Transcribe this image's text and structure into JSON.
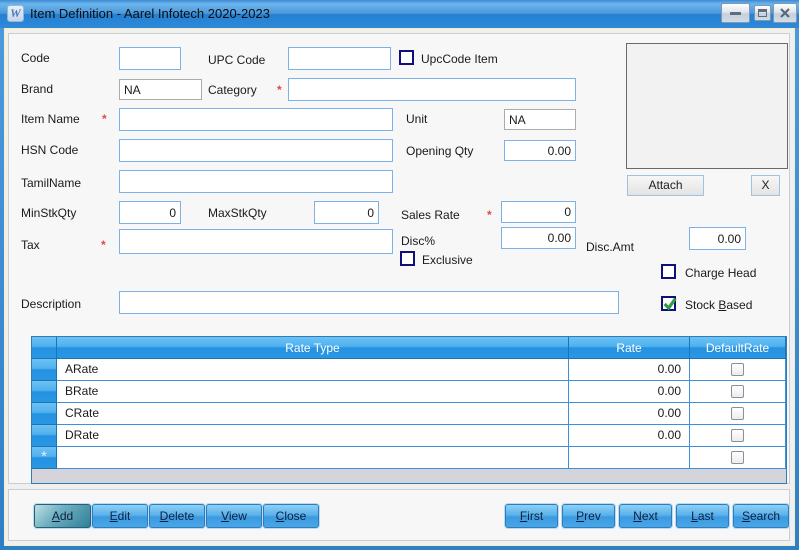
{
  "window": {
    "title": "Item Definition - Aarel Infotech 2020-2023"
  },
  "form": {
    "fields": {
      "code": {
        "label": "Code",
        "value": ""
      },
      "upc_code": {
        "label": "UPC Code",
        "value": ""
      },
      "upccode_item": {
        "label": "UpcCode Item",
        "checked": false
      },
      "brand": {
        "label": "Brand",
        "value": "NA"
      },
      "category": {
        "label": "Category",
        "required": "*",
        "value": ""
      },
      "item_name": {
        "label": "Item Name",
        "required": "*",
        "value": ""
      },
      "unit": {
        "label": "Unit",
        "value": "NA"
      },
      "hsn_code": {
        "label": "HSN Code",
        "value": ""
      },
      "opening_qty": {
        "label": "Opening Qty",
        "value": "0.00"
      },
      "tamil_name": {
        "label": "TamilName",
        "value": ""
      },
      "min_stk_qty": {
        "label": "MinStkQty",
        "value": "0"
      },
      "max_stk_qty": {
        "label": "MaxStkQty",
        "value": "0"
      },
      "sales_rate": {
        "label": "Sales Rate",
        "required": "*",
        "value": "0"
      },
      "tax": {
        "label": "Tax",
        "required": "*",
        "value": ""
      },
      "disc_pct": {
        "label": "Disc%",
        "value": "0.00"
      },
      "disc_amt": {
        "label": "Disc.Amt",
        "value": "0.00"
      },
      "exclusive": {
        "label": "Exclusive",
        "checked": false
      },
      "charge_head": {
        "label": "Charge Head",
        "checked": false
      },
      "stock_based": {
        "text": "Stock Based",
        "mnemonic": "B",
        "checked": true
      },
      "description": {
        "label": "Description",
        "value": ""
      }
    },
    "attach": {
      "attach_label": "Attach",
      "clear_label": "X"
    }
  },
  "grid": {
    "columns": [
      "Rate Type",
      "Rate",
      "DefaultRate"
    ],
    "rows": [
      {
        "rate_type": "ARate",
        "rate": "0.00",
        "default_rate": false
      },
      {
        "rate_type": "BRate",
        "rate": "0.00",
        "default_rate": false
      },
      {
        "rate_type": "CRate",
        "rate": "0.00",
        "default_rate": false
      },
      {
        "rate_type": "DRate",
        "rate": "0.00",
        "default_rate": false
      }
    ],
    "new_row_marker": "*"
  },
  "buttons": {
    "left": [
      {
        "text": "Add",
        "mnemonic": "A"
      },
      {
        "text": "Edit",
        "mnemonic": "E"
      },
      {
        "text": "Delete",
        "mnemonic": "D"
      },
      {
        "text": "View",
        "mnemonic": "V"
      },
      {
        "text": "Close",
        "mnemonic": "C"
      }
    ],
    "right": [
      {
        "text": "First",
        "mnemonic": "F"
      },
      {
        "text": "Prev",
        "mnemonic": "P"
      },
      {
        "text": "Next",
        "mnemonic": "N"
      },
      {
        "text": "Last",
        "mnemonic": "L"
      },
      {
        "text": "Search",
        "mnemonic": "S"
      }
    ]
  },
  "colors": {
    "title_bar_blue": "#2f86d8",
    "grid_header_blue": "#2492e0",
    "button_blue": "#4aa6e6",
    "required_red": "#e04848",
    "check_green": "#2f9e44",
    "checkbox_navy": "#10107a"
  }
}
